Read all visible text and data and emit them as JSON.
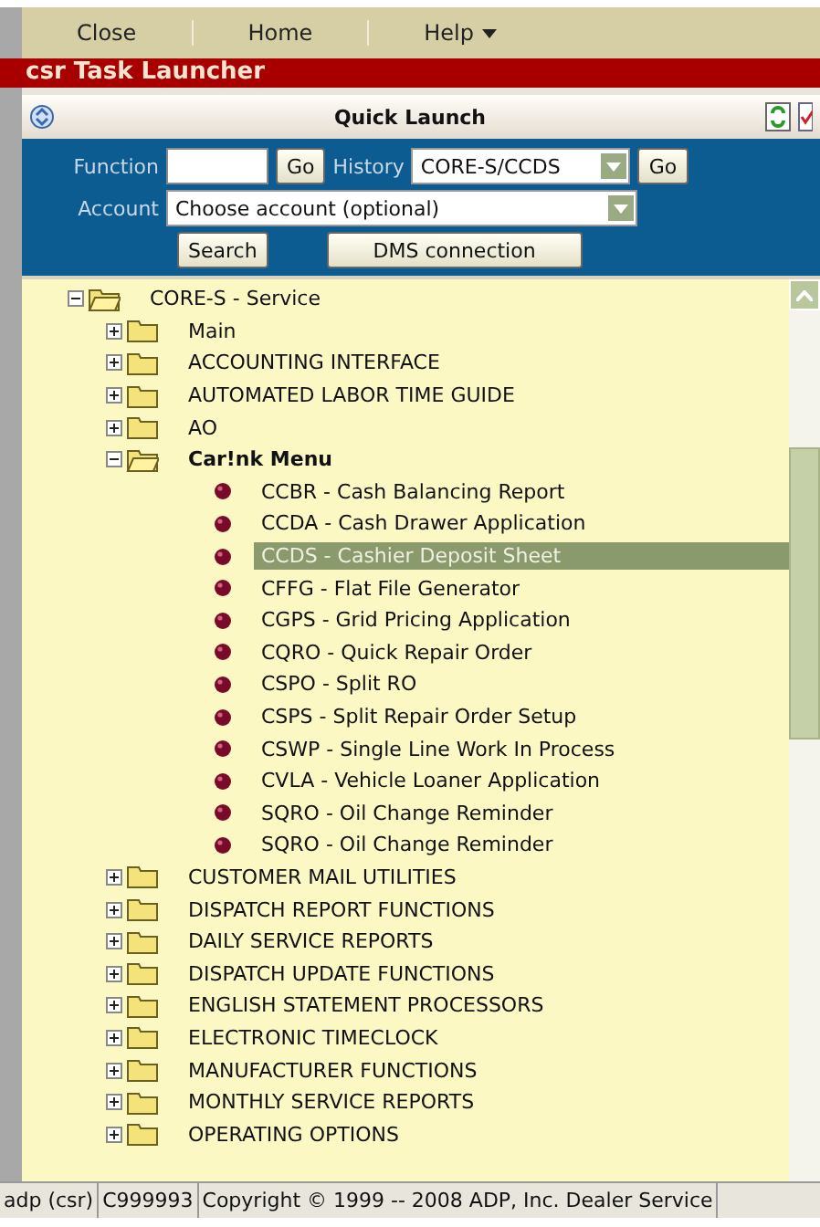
{
  "menu": [
    {
      "label": "Close",
      "dropdown": false
    },
    {
      "label": "Home",
      "dropdown": false
    },
    {
      "label": "Help",
      "dropdown": true
    }
  ],
  "title": "csr Task Launcher",
  "quick_launch": {
    "title": "Quick Launch",
    "function_label": "Function",
    "go_label": "Go",
    "history_label": "History",
    "history_value": "CORE-S/CCDS",
    "history_go_label": "Go",
    "account_label": "Account",
    "account_value": "Choose account (optional)",
    "search_label": "Search",
    "dms_label": "DMS connection"
  },
  "tree": [
    {
      "label": "CORE-S - Service",
      "kind": "folder",
      "expanded": true,
      "bold": false,
      "children": [
        {
          "label": "Main",
          "kind": "folder",
          "expanded": false,
          "bold": false
        },
        {
          "label": "ACCOUNTING INTERFACE",
          "kind": "folder",
          "expanded": false,
          "bold": false
        },
        {
          "label": "AUTOMATED LABOR TIME GUIDE",
          "kind": "folder",
          "expanded": false,
          "bold": false
        },
        {
          "label": "AO",
          "kind": "folder",
          "expanded": false,
          "bold": false
        },
        {
          "label": "Car!nk Menu",
          "kind": "folder",
          "expanded": true,
          "bold": true,
          "children": [
            {
              "label": "CCBR - Cash Balancing Report",
              "kind": "leaf",
              "selected": false
            },
            {
              "label": "CCDA - Cash Drawer Application",
              "kind": "leaf",
              "selected": false
            },
            {
              "label": "CCDS - Cashier Deposit Sheet",
              "kind": "leaf",
              "selected": true
            },
            {
              "label": "CFFG - Flat File Generator",
              "kind": "leaf",
              "selected": false
            },
            {
              "label": "CGPS - Grid Pricing Application",
              "kind": "leaf",
              "selected": false
            },
            {
              "label": "CQRO - Quick Repair Order",
              "kind": "leaf",
              "selected": false
            },
            {
              "label": "CSPO - Split RO",
              "kind": "leaf",
              "selected": false
            },
            {
              "label": "CSPS - Split Repair Order Setup",
              "kind": "leaf",
              "selected": false
            },
            {
              "label": "CSWP - Single Line Work In Process",
              "kind": "leaf",
              "selected": false
            },
            {
              "label": "CVLA - Vehicle Loaner Application",
              "kind": "leaf",
              "selected": false
            },
            {
              "label": "SQRO - Oil Change Reminder",
              "kind": "leaf",
              "selected": false
            },
            {
              "label": "SQRO - Oil Change Reminder",
              "kind": "leaf",
              "selected": false
            }
          ]
        },
        {
          "label": "CUSTOMER MAIL UTILITIES",
          "kind": "folder",
          "expanded": false,
          "bold": false
        },
        {
          "label": "DISPATCH REPORT FUNCTIONS",
          "kind": "folder",
          "expanded": false,
          "bold": false
        },
        {
          "label": "DAILY SERVICE REPORTS",
          "kind": "folder",
          "expanded": false,
          "bold": false
        },
        {
          "label": "DISPATCH UPDATE FUNCTIONS",
          "kind": "folder",
          "expanded": false,
          "bold": false
        },
        {
          "label": "ENGLISH STATEMENT PROCESSORS",
          "kind": "folder",
          "expanded": false,
          "bold": false
        },
        {
          "label": "ELECTRONIC TIMECLOCK",
          "kind": "folder",
          "expanded": false,
          "bold": false
        },
        {
          "label": "MANUFACTURER FUNCTIONS",
          "kind": "folder",
          "expanded": false,
          "bold": false
        },
        {
          "label": "MONTHLY SERVICE REPORTS",
          "kind": "folder",
          "expanded": false,
          "bold": false
        },
        {
          "label": "OPERATING OPTIONS",
          "kind": "folder",
          "expanded": false,
          "bold": false
        }
      ]
    }
  ],
  "status_bar": [
    "adp (csr)",
    "C999993",
    "Copyright © 1999 -- 2008 ADP, Inc. Dealer Service"
  ]
}
